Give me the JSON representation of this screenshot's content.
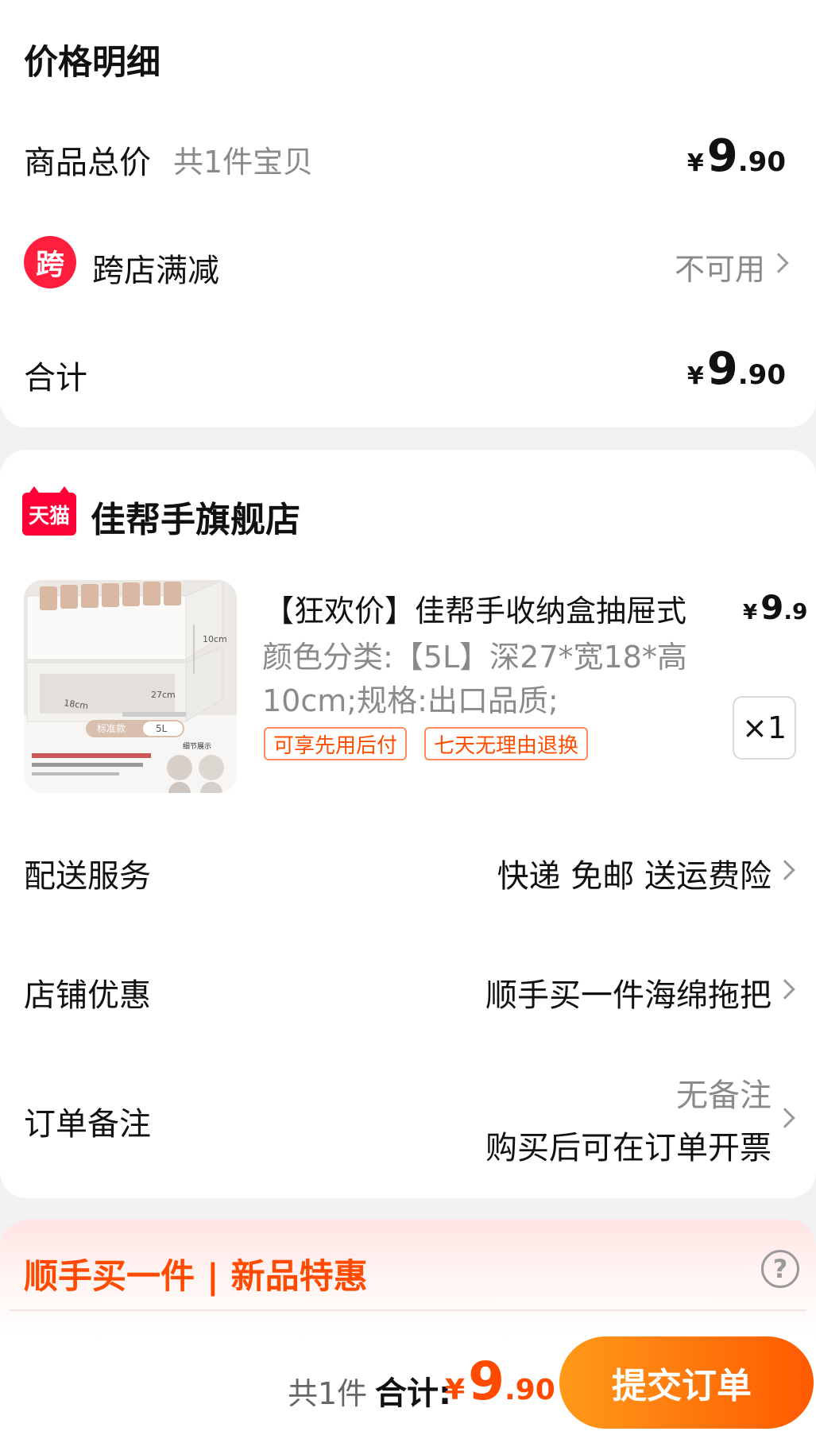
{
  "price_details": {
    "title": "价格明细",
    "goods_total_label": "商品总价",
    "goods_count": "共1件宝贝",
    "goods_total": {
      "currency": "¥",
      "int": "9",
      "dec": ".90"
    },
    "cross_store_badge": "跨",
    "cross_store_label": "跨店满减",
    "cross_store_value": "不可用",
    "total_label": "合计",
    "total": {
      "currency": "¥",
      "int": "9",
      "dec": ".90"
    }
  },
  "store": {
    "logo_text": "天猫",
    "name": "佳帮手旗舰店"
  },
  "item": {
    "title": "【狂欢价】佳帮手收纳盒抽屉式",
    "price": {
      "currency": "¥",
      "int": "9",
      "dec": ".9"
    },
    "spec": "颜色分类:【5L】深27*宽18*高10cm;规格:出口品质;",
    "tags": [
      "可享先用后付",
      "七天无理由退换"
    ],
    "quantity": "×1",
    "image_labels": {
      "height": "10cm",
      "depth": "27cm",
      "width": "18cm",
      "style": "标准款",
      "volume": "5L",
      "detail": "细节展示"
    }
  },
  "services": {
    "delivery_label": "配送服务",
    "delivery_value": "快递 免邮 送运费险",
    "discount_label": "店铺优惠",
    "discount_value": "顺手买一件海绵拖把",
    "note_label": "订单备注",
    "note_value": "无备注",
    "invoice_value": "购买后可在订单开票"
  },
  "addon": {
    "title": "顺手买一件 | 新品特惠",
    "help_icon": "?"
  },
  "bottom_bar": {
    "count": "共1件",
    "total_label": "合计:",
    "total": {
      "currency": "¥",
      "int": "9",
      "dec": ".90"
    },
    "submit_label": "提交订单"
  },
  "colors": {
    "accent": "#ff4a00",
    "badge_red": "#ff1f3d",
    "tmall_red": "#ff0036"
  }
}
